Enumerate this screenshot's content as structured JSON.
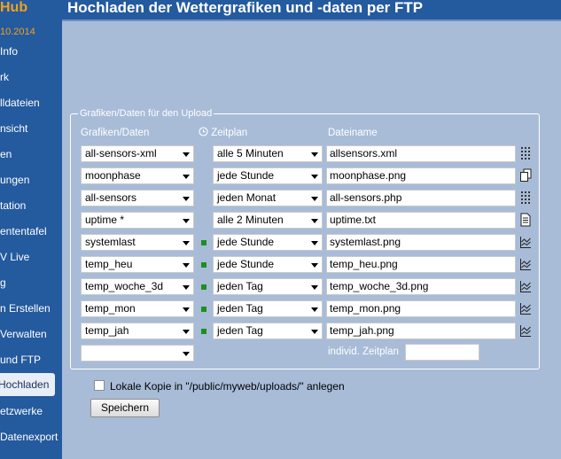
{
  "sidebar": {
    "brand": "Hub",
    "date": "10.2014",
    "items": [
      {
        "label": " Info"
      },
      {
        "label": "rk"
      },
      {
        "label": "lldateien"
      },
      {
        "label": "nsicht"
      },
      {
        "label": "en"
      },
      {
        "label": "ungen"
      },
      {
        "label": "tation"
      },
      {
        "label": "ententafel"
      },
      {
        "label": "V Live"
      },
      {
        "label": "g"
      },
      {
        "label": "n Erstellen"
      },
      {
        "label": " Verwalten"
      },
      {
        "label": "und FTP"
      },
      {
        "label": " Hochladen"
      },
      {
        "label": "etzwerke"
      },
      {
        "label": " Datenexport"
      }
    ]
  },
  "header": {
    "title": "Hochladen der Wettergrafiken und -daten per FTP"
  },
  "panel": {
    "legend": "Grafiken/Daten für den Upload",
    "col_graphs": "Grafiken/Daten",
    "col_schedule": "Zeitplan",
    "col_filename": "Dateiname",
    "rows": [
      {
        "source": "all-sensors-xml",
        "schedule": "alle 5 Minuten",
        "filename": "allsensors.xml",
        "icon": "table-icon",
        "dot": false
      },
      {
        "source": "moonphase",
        "schedule": "jede Stunde",
        "filename": "moonphase.png",
        "icon": "copy-icon",
        "dot": false
      },
      {
        "source": "all-sensors",
        "schedule": "jeden Monat",
        "filename": "all-sensors.php",
        "icon": "table-icon",
        "dot": false
      },
      {
        "source": "uptime *",
        "schedule": "alle 2 Minuten",
        "filename": "uptime.txt",
        "icon": "document-icon",
        "dot": false
      },
      {
        "source": "systemlast",
        "schedule": "jede Stunde",
        "filename": "systemlast.png",
        "icon": "chart-icon",
        "dot": true
      },
      {
        "source": "temp_heu",
        "schedule": "jede Stunde",
        "filename": "temp_heu.png",
        "icon": "chart-icon",
        "dot": true
      },
      {
        "source": "temp_woche_3d",
        "schedule": "jeden Tag",
        "filename": "temp_woche_3d.png",
        "icon": "chart-icon",
        "dot": true
      },
      {
        "source": "temp_mon",
        "schedule": "jeden Tag",
        "filename": "temp_mon.png",
        "icon": "chart-icon",
        "dot": true
      },
      {
        "source": "temp_jah",
        "schedule": "jeden Tag",
        "filename": "temp_jah.png",
        "icon": "chart-icon",
        "dot": true
      }
    ],
    "new_source": "",
    "individual_schedule_label": "individ. Zeitplan",
    "individual_schedule_value": ""
  },
  "local_copy": {
    "checked": false,
    "label": "Lokale Kopie in \"/public/myweb/uploads/\" anlegen"
  },
  "save_button": "Speichern",
  "colors": {
    "header_bg": "#245a9e",
    "page_bg": "#a8bcd8",
    "brand": "#f0a020",
    "dot": "#1e8f1e"
  }
}
